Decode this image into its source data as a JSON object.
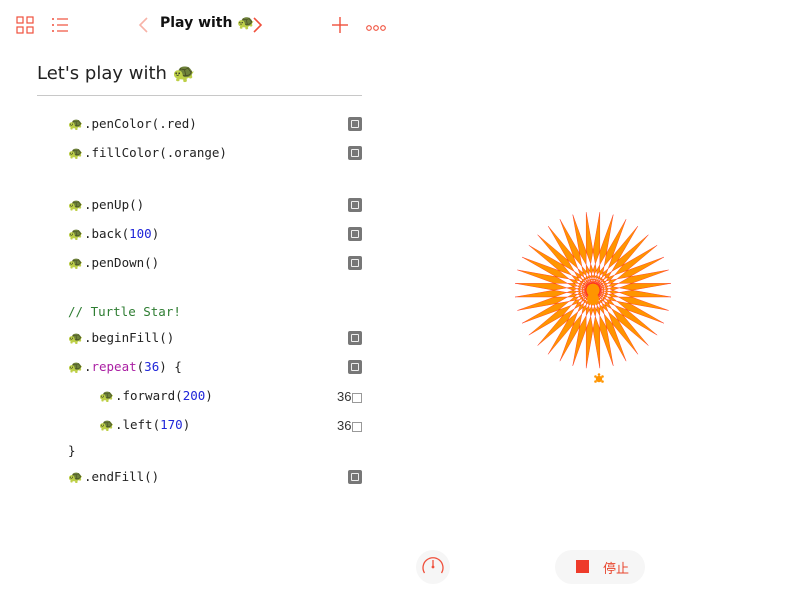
{
  "toolbar": {
    "title": "Play with",
    "title_emoji": "🐢"
  },
  "heading": {
    "text": "Let's play with",
    "emoji": "🐢"
  },
  "code": {
    "turtle": "🐢",
    "lines": [
      {
        "name": "penColor",
        "parts": [
          ".penColor(.red)"
        ]
      },
      {
        "name": "fillColor",
        "parts": [
          ".fillColor(.orange)"
        ]
      },
      {
        "name": "penUp",
        "parts": [
          ".penUp()"
        ]
      },
      {
        "name": "back",
        "pre": ".back(",
        "num": "100",
        "post": ")"
      },
      {
        "name": "penDown",
        "parts": [
          ".penDown()"
        ]
      },
      {
        "name": "comment",
        "text": "// Turtle Star!"
      },
      {
        "name": "beginFill",
        "parts": [
          ".beginFill()"
        ]
      },
      {
        "name": "repeat",
        "pre": ".",
        "kw": "repeat",
        "mid": "(",
        "num": "36",
        "post": ") {"
      },
      {
        "name": "forward",
        "pre": ".forward(",
        "num": "200",
        "post": ")",
        "count": "36"
      },
      {
        "name": "left",
        "pre": ".left(",
        "num": "170",
        "post": ")",
        "count": "36"
      },
      {
        "name": "close",
        "text": "}"
      },
      {
        "name": "endFill",
        "parts": [
          ".endFill()"
        ]
      }
    ]
  },
  "canvas": {
    "pen_color": "#ff2a1a",
    "fill_color": "#ff9500",
    "repeat_count": 36,
    "forward_distance": 200,
    "left_angle": 170
  },
  "controls": {
    "stop_label": "停止",
    "accent": "#f0503c"
  }
}
